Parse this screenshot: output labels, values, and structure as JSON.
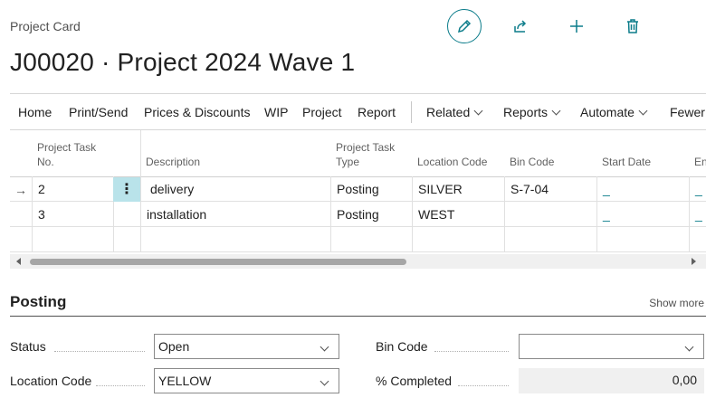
{
  "header": {
    "caption": "Project Card",
    "title": "J00020 · Project 2024 Wave 1"
  },
  "actions": {
    "edit_icon": "pencil-icon",
    "share_icon": "share-icon",
    "new_icon": "plus-icon",
    "delete_icon": "trash-icon"
  },
  "menu": {
    "items": [
      "Home",
      "Print/Send",
      "Prices & Discounts",
      "WIP",
      "Project",
      "Report"
    ],
    "dropdowns": [
      "Related",
      "Reports",
      "Automate"
    ],
    "fewer": "Fewer"
  },
  "grid": {
    "columns": [
      "Project Task No.",
      "Description",
      "Project Task Type",
      "Location Code",
      "Bin Code",
      "Start Date",
      "En"
    ],
    "rows": [
      {
        "task_no": "2",
        "description": "delivery",
        "type": "Posting",
        "location": "SILVER",
        "bin": "S-7-04",
        "start": "_",
        "end": "_"
      },
      {
        "task_no": "3",
        "description": "installation",
        "type": "Posting",
        "location": "WEST",
        "bin": "",
        "start": "_",
        "end": "_"
      }
    ],
    "row_menu": "⋮",
    "current_row_marker": "→"
  },
  "posting": {
    "title": "Posting",
    "show_more": "Show more",
    "status_label": "Status",
    "status_value": "Open",
    "location_label": "Location Code",
    "location_value": "YELLOW",
    "bin_label": "Bin Code",
    "bin_value": "",
    "completed_label": "% Completed",
    "completed_value": "0,00"
  },
  "colors": {
    "accent": "#0b7c8a",
    "selected_cell": "#b9e3ea"
  }
}
